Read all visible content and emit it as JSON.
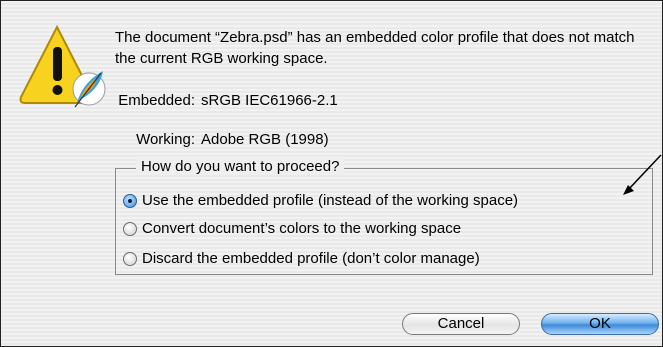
{
  "dialog": {
    "message": "The document “Zebra.psd” has an embedded color profile that does not match the current RGB working space.",
    "embedded_label": "Embedded:",
    "embedded_value": "sRGB IEC61966-2.1",
    "working_label": "Working:",
    "working_value": "Adobe RGB (1998)",
    "group_legend": "How do you want to proceed?",
    "options": [
      {
        "label": "Use the embedded profile (instead of the working space)",
        "selected": true
      },
      {
        "label": "Convert document’s colors to the working space",
        "selected": false
      },
      {
        "label": "Discard the embedded profile (don’t color manage)",
        "selected": false
      }
    ],
    "cancel_label": "Cancel",
    "ok_label": "OK"
  },
  "icons": {
    "warning": "warning-triangle-icon",
    "app_badge": "feather-icon",
    "annotation": "arrow-icon",
    "radio": "radio-button"
  },
  "colors": {
    "warning_yellow": "#f7d21e",
    "ok_button_blue": "#4a94de",
    "radio_selected": "#3d8fe0"
  }
}
